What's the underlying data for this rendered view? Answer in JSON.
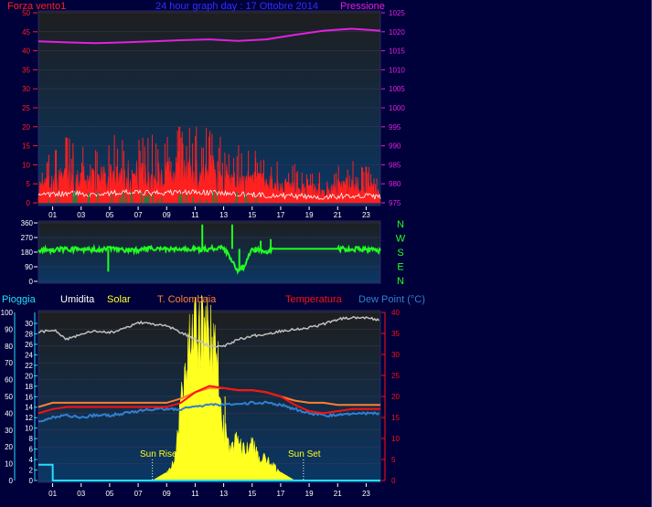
{
  "header": {
    "left_label": "Forza vento1",
    "title": "24 hour graph day : 17 Ottobre 2014",
    "right_label": "Pressione"
  },
  "compass": [
    "N",
    "W",
    "S",
    "E",
    "N"
  ],
  "bottom_labels": {
    "rain": "Pioggia",
    "humidity": "Umidita",
    "solar": "Solar",
    "tcol": "T. Colombaia",
    "temp": "Temperatura",
    "dew": "Dew Point (°C)"
  },
  "annotations": {
    "sunrise": "Sun Rise",
    "sunset": "Sun Set"
  },
  "colors": {
    "bg": "#00003a",
    "plot_top": "#1e1e1e",
    "plot_bottom": "#0a3766",
    "wind_left": "#ff2020",
    "pressure": "#e020e0",
    "wind_dir": "#20ff20",
    "rain": "#20e0ff",
    "humidity": "#c0c0c0",
    "solar": "#ffff20",
    "tcol": "#ff8030",
    "temp": "#ff1010",
    "dew": "#3080d0",
    "text_white": "#ffffff"
  },
  "chart_data": [
    {
      "type": "line",
      "title": "24 hour graph day : 17 Ottobre 2014",
      "x_ticks": [
        "01",
        "03",
        "05",
        "07",
        "09",
        "11",
        "13",
        "15",
        "17",
        "19",
        "21",
        "23"
      ],
      "y_left": {
        "label": "Forza vento1",
        "ticks": [
          0,
          5,
          10,
          15,
          20,
          25,
          30,
          35,
          40,
          45,
          50
        ],
        "ylim": [
          0,
          50
        ]
      },
      "y_right": {
        "label": "Pressione",
        "ticks": [
          975,
          980,
          985,
          990,
          995,
          1000,
          1005,
          1010,
          1015,
          1020,
          1025
        ],
        "ylim": [
          975,
          1025
        ]
      },
      "series": [
        {
          "name": "Pressione",
          "axis": "right",
          "x": [
            0,
            2,
            4,
            6,
            8,
            10,
            12,
            14,
            16,
            17,
            18,
            20,
            22,
            24
          ],
          "y": [
            1017.5,
            1017.2,
            1017,
            1017.2,
            1017.5,
            1017.8,
            1018,
            1017.6,
            1018,
            1018.6,
            1019.2,
            1020.3,
            1020.8,
            1020.3
          ]
        },
        {
          "name": "Forza vento1",
          "axis": "left",
          "x": [
            0,
            2,
            4,
            6,
            8,
            10,
            12,
            14,
            16,
            18,
            20,
            22,
            24
          ],
          "y": [
            4,
            7,
            6,
            8,
            7,
            8,
            8,
            6,
            5,
            4,
            3,
            5,
            3
          ]
        }
      ]
    },
    {
      "type": "line",
      "y_ticks": [
        0,
        90,
        180,
        270,
        360
      ],
      "ylim": [
        0,
        360
      ],
      "series": [
        {
          "name": "wind direction",
          "x": [
            0,
            2,
            3.5,
            5,
            6,
            8,
            10,
            12,
            13,
            14,
            14.5,
            15,
            16,
            17,
            18,
            20,
            22,
            24
          ],
          "y": [
            190,
            200,
            195,
            200,
            190,
            200,
            195,
            200,
            210,
            60,
            100,
            200,
            185,
            200,
            200,
            200,
            200,
            190
          ]
        }
      ]
    },
    {
      "type": "line",
      "x_ticks": [
        "01",
        "03",
        "05",
        "07",
        "09",
        "11",
        "13",
        "15",
        "17",
        "19",
        "21",
        "23"
      ],
      "y_left_ticks": [
        0,
        10,
        20,
        30,
        40,
        50,
        60,
        70,
        80,
        90,
        100
      ],
      "y_rain_ticks": [
        0,
        2,
        4,
        6,
        8,
        10,
        12,
        14,
        16,
        18,
        20,
        22,
        24,
        26,
        28,
        30
      ],
      "y_right": {
        "ticks": [
          0,
          5,
          10,
          15,
          20,
          25,
          30,
          35,
          40
        ],
        "ylim": [
          0,
          40
        ]
      },
      "series": [
        {
          "name": "Umidita",
          "x": [
            0,
            1,
            2,
            3,
            4,
            5,
            6,
            7,
            8,
            9,
            10,
            11,
            12,
            13,
            14,
            15,
            16,
            17,
            18,
            19,
            20,
            21,
            22,
            23,
            24
          ],
          "y": [
            88,
            90,
            84,
            87,
            89,
            88,
            90,
            94,
            93,
            92,
            88,
            84,
            80,
            80,
            84,
            86,
            87,
            89,
            90,
            91,
            93,
            96,
            97,
            97,
            95
          ]
        },
        {
          "name": "T. Colombaia",
          "x": [
            0,
            1,
            2,
            3,
            4,
            5,
            6,
            7,
            8,
            9,
            10,
            11,
            12,
            13,
            14,
            15,
            16,
            17,
            18,
            19,
            20,
            21,
            22,
            23,
            24
          ],
          "y": [
            17.5,
            18.5,
            18.5,
            18.5,
            18.5,
            18.5,
            18.5,
            18.5,
            18.5,
            18.5,
            19.5,
            21,
            22,
            22,
            21.5,
            21.5,
            21,
            20,
            19,
            18.5,
            18.5,
            18,
            18,
            18,
            18
          ]
        },
        {
          "name": "Temperatura",
          "x": [
            0,
            1,
            2,
            3,
            4,
            5,
            6,
            7,
            8,
            9,
            10,
            11,
            12,
            13,
            14,
            15,
            16,
            17,
            18,
            19,
            20,
            21,
            22,
            23,
            24
          ],
          "y": [
            16,
            17,
            17.5,
            17.5,
            17.5,
            17.5,
            17.5,
            17.5,
            17.5,
            17.5,
            18.5,
            21,
            22.5,
            22,
            21.5,
            21.5,
            21,
            20,
            18,
            16.5,
            16,
            16.5,
            17,
            17,
            17
          ]
        },
        {
          "name": "Dew Point",
          "x": [
            0,
            1,
            2,
            3,
            4,
            5,
            6,
            7,
            8,
            9,
            10,
            11,
            12,
            13,
            14,
            15,
            16,
            17,
            18,
            19,
            20,
            21,
            22,
            23,
            24
          ],
          "y": [
            14,
            15,
            15.5,
            15,
            15.5,
            15.5,
            16,
            16.5,
            17,
            17,
            17,
            17.5,
            18,
            18,
            18,
            18.5,
            18.5,
            18,
            17,
            16,
            15.5,
            15.5,
            16,
            16,
            16
          ]
        },
        {
          "name": "Solar",
          "x": [
            7,
            8,
            9,
            9.5,
            10,
            10.5,
            11,
            11.5,
            12,
            12.5,
            13,
            13.5,
            14,
            14.5,
            15,
            15.5,
            16,
            16.5,
            17,
            17.5,
            18
          ],
          "y": [
            0,
            0,
            2,
            5,
            20,
            35,
            40,
            42,
            40,
            36,
            15,
            8,
            12,
            8,
            10,
            6,
            6,
            4,
            2,
            1,
            0
          ]
        },
        {
          "name": "Pioggia",
          "x": [
            0,
            1,
            1.01,
            24
          ],
          "y": [
            3,
            3,
            0,
            0
          ]
        }
      ],
      "markers": {
        "sunrise_hour": 8,
        "sunset_hour": 18.6
      }
    }
  ]
}
